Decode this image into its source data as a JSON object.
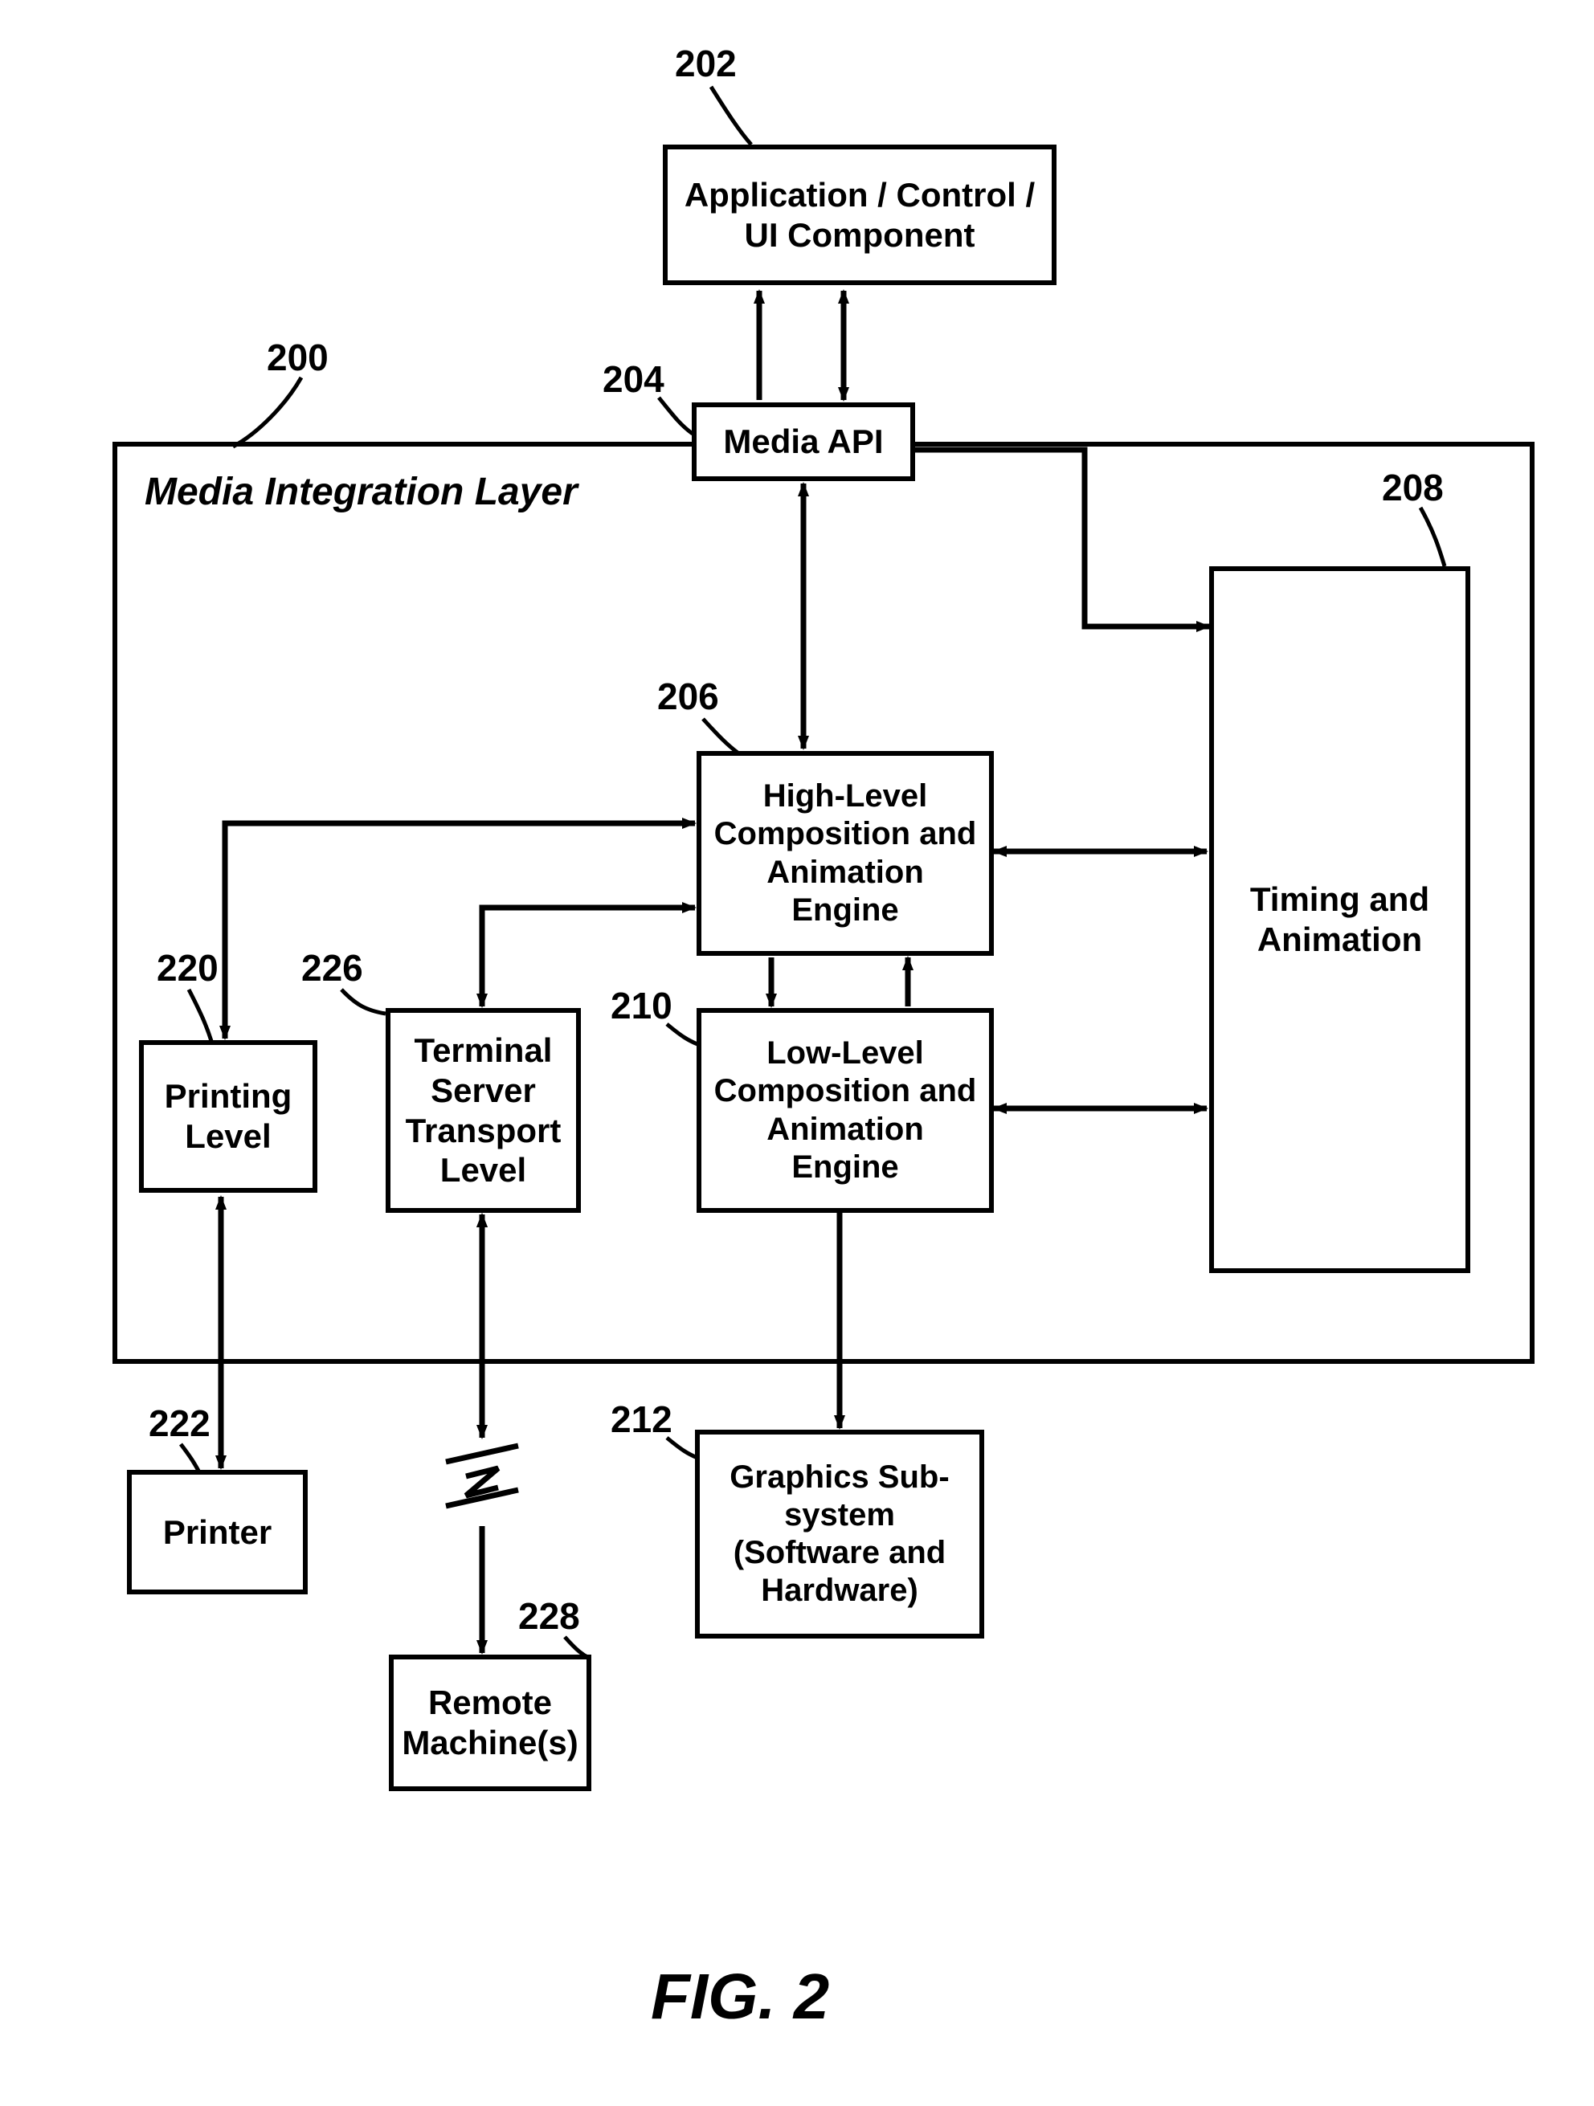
{
  "figure_caption": "FIG. 2",
  "container": {
    "title": "Media Integration Layer",
    "ref": "200"
  },
  "blocks": {
    "app": {
      "ref": "202",
      "text": "Application / Control / UI Component"
    },
    "media_api": {
      "ref": "204",
      "text": "Media API"
    },
    "hl_engine": {
      "ref": "206",
      "text": "High-Level Composition and Animation Engine"
    },
    "timing": {
      "ref": "208",
      "text": "Timing and Animation"
    },
    "ll_engine": {
      "ref": "210",
      "text": "Low-Level Composition and Animation Engine"
    },
    "graphics": {
      "ref": "212",
      "text": "Graphics Sub-system (Software and Hardware)"
    },
    "printing": {
      "ref": "220",
      "text": "Printing Level"
    },
    "printer": {
      "ref": "222",
      "text": "Printer"
    },
    "terminal": {
      "ref": "226",
      "text": "Terminal Server Transport Level"
    },
    "remote": {
      "ref": "228",
      "text": "Remote Machine(s)"
    }
  }
}
